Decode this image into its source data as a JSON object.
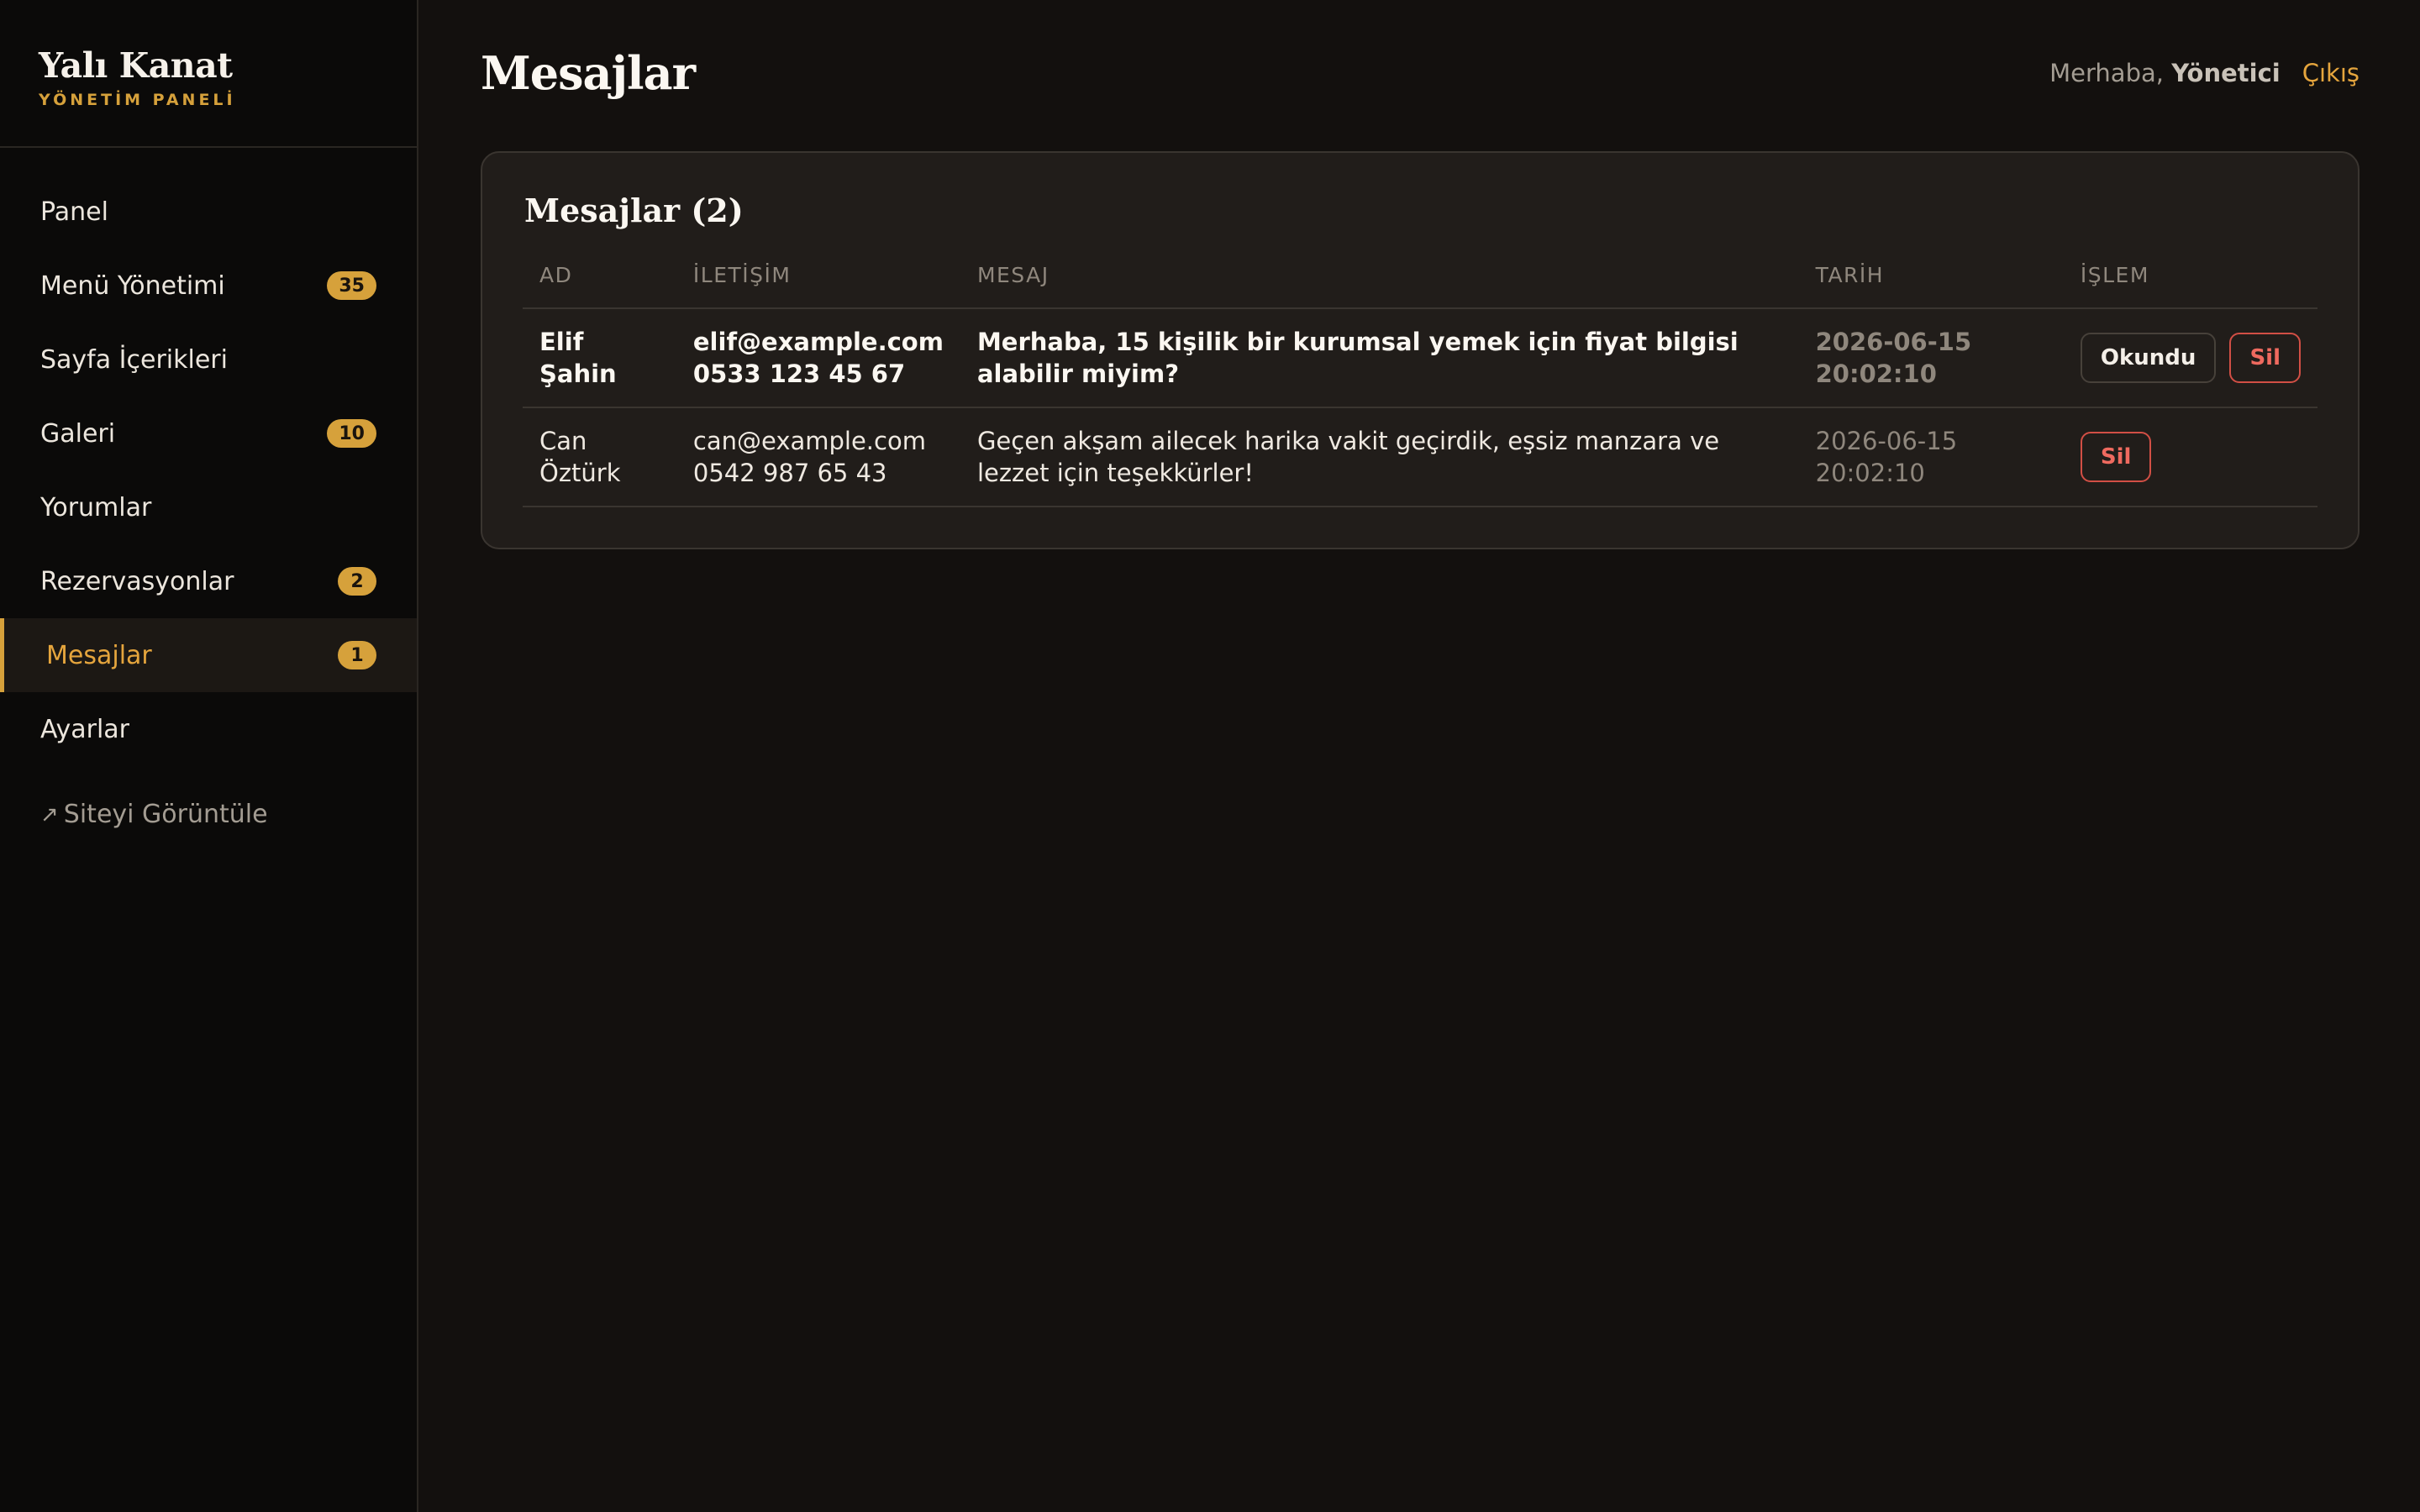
{
  "brand": {
    "title": "Yalı Kanat",
    "subtitle": "YÖNETİM PANELİ"
  },
  "sidebar": {
    "items": [
      {
        "label": "Panel",
        "badge": null
      },
      {
        "label": "Menü Yönetimi",
        "badge": "35"
      },
      {
        "label": "Sayfa İçerikleri",
        "badge": null
      },
      {
        "label": "Galeri",
        "badge": "10"
      },
      {
        "label": "Yorumlar",
        "badge": null
      },
      {
        "label": "Rezervasyonlar",
        "badge": "2"
      },
      {
        "label": "Mesajlar",
        "badge": "1"
      },
      {
        "label": "Ayarlar",
        "badge": null
      }
    ],
    "active": "Mesajlar",
    "site_link": "Siteyi Görüntüle",
    "site_link_icon": "↗"
  },
  "header": {
    "title": "Mesajlar",
    "greeting": "Merhaba,",
    "user": "Yönetici",
    "logout": "Çıkış"
  },
  "messages": {
    "title": "Mesajlar (2)",
    "columns": [
      "AD",
      "İLETİŞİM",
      "MESAJ",
      "TARİH",
      "İŞLEM"
    ],
    "rows": [
      {
        "name": "Elif Şahin",
        "email": "elif@example.com",
        "phone": "0533 123 45 67",
        "message": "Merhaba, 15 kişilik bir kurumsal yemek için fiyat bilgisi alabilir miyim?",
        "date": "2026-06-15 20:02:10",
        "read_label": "Okundu",
        "delete_label": "Sil"
      },
      {
        "name": "Can Öztürk",
        "email": "can@example.com",
        "phone": "0542 987 65 43",
        "message": "Geçen akşam ailecek harika vakit geçirdik, eşsiz manzara ve lezzet için teşekkürler!",
        "date": "2026-06-15 20:02:10",
        "delete_label": "Sil"
      }
    ]
  },
  "colors": {
    "accent": "#d6a13b",
    "danger": "#d24f45",
    "background": "#13100e",
    "card": "#211d1a"
  }
}
